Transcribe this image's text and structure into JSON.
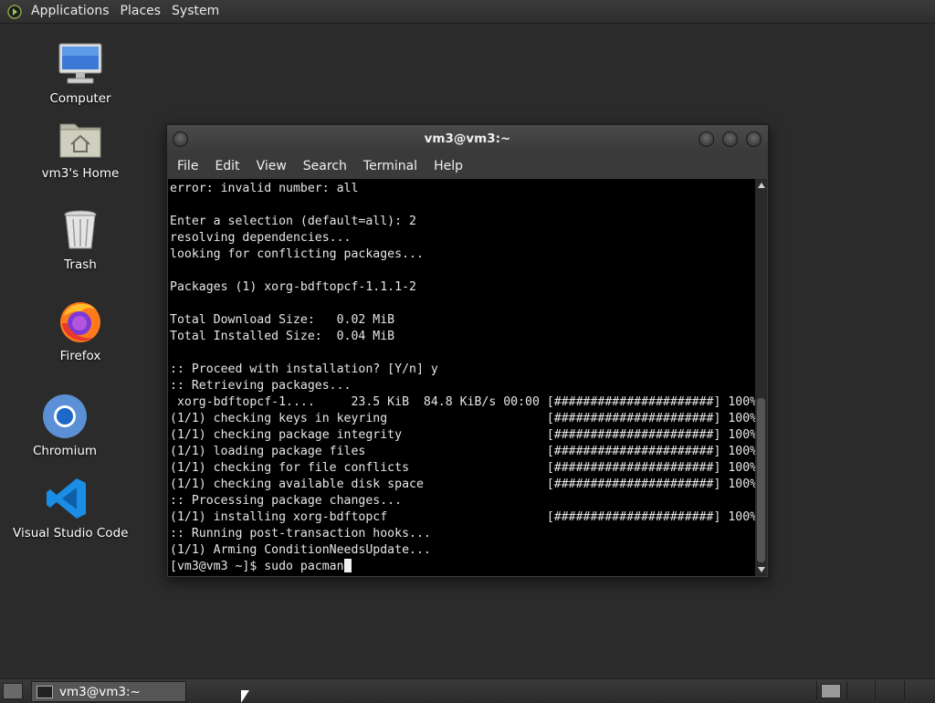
{
  "top_panel": {
    "menus": [
      "Applications",
      "Places",
      "System"
    ]
  },
  "desktop": {
    "icons": [
      {
        "label": "Computer"
      },
      {
        "label": "vm3's Home"
      },
      {
        "label": "Trash"
      },
      {
        "label": "Firefox"
      },
      {
        "label": "Chromium"
      },
      {
        "label": "Visual Studio Code"
      }
    ]
  },
  "terminal": {
    "title": "vm3@vm3:~",
    "menu": [
      "File",
      "Edit",
      "View",
      "Search",
      "Terminal",
      "Help"
    ],
    "lines": [
      "error: invalid number: all",
      "",
      "Enter a selection (default=all): 2",
      "resolving dependencies...",
      "looking for conflicting packages...",
      "",
      "Packages (1) xorg-bdftopcf-1.1.1-2",
      "",
      "Total Download Size:   0.02 MiB",
      "Total Installed Size:  0.04 MiB",
      "",
      ":: Proceed with installation? [Y/n] y",
      ":: Retrieving packages...",
      " xorg-bdftopcf-1....     23.5 KiB  84.8 KiB/s 00:00 [######################] 100%",
      "(1/1) checking keys in keyring                      [######################] 100%",
      "(1/1) checking package integrity                    [######################] 100%",
      "(1/1) loading package files                         [######################] 100%",
      "(1/1) checking for file conflicts                   [######################] 100%",
      "(1/1) checking available disk space                 [######################] 100%",
      ":: Processing package changes...",
      "(1/1) installing xorg-bdftopcf                      [######################] 100%",
      ":: Running post-transaction hooks...",
      "(1/1) Arming ConditionNeedsUpdate..."
    ],
    "prompt": "[vm3@vm3 ~]$ ",
    "command": "sudo pacman"
  },
  "bottom_panel": {
    "task_label": "vm3@vm3:~"
  }
}
